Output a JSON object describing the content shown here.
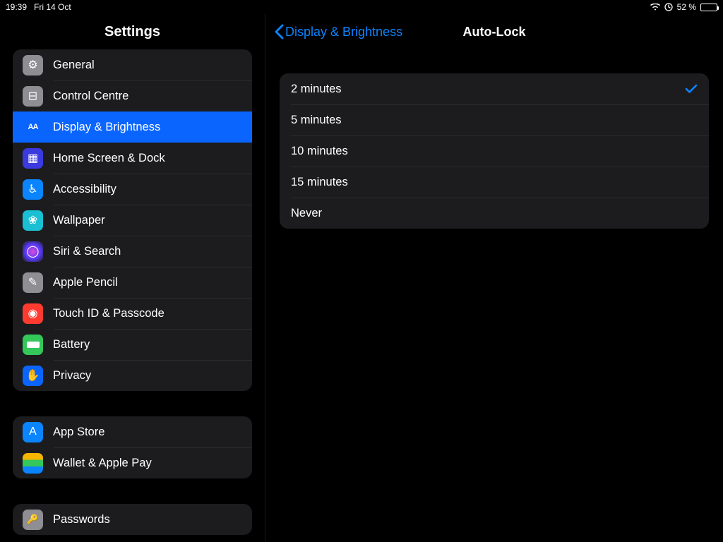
{
  "status": {
    "time": "19:39",
    "date": "Fri 14 Oct",
    "battery_pct": "52 %",
    "battery_fill_pct": 52
  },
  "sidebar": {
    "title": "Settings",
    "groups": [
      {
        "items": [
          {
            "id": "general",
            "label": "General",
            "icon": "gear-icon",
            "bg": "#8e8e93",
            "glyph": "⚙︎"
          },
          {
            "id": "control-centre",
            "label": "Control Centre",
            "icon": "switches-icon",
            "bg": "#8e8e93",
            "glyph": "⊟"
          },
          {
            "id": "display",
            "label": "Display & Brightness",
            "icon": "aa-icon",
            "bg": "#0a65ff",
            "glyph": "AA",
            "selected": true
          },
          {
            "id": "home-screen",
            "label": "Home Screen & Dock",
            "icon": "grid-icon",
            "bg": "#3a3adf",
            "glyph": "▦"
          },
          {
            "id": "accessibility",
            "label": "Accessibility",
            "icon": "person-circle-icon",
            "bg": "#0a84ff",
            "glyph": "♿︎"
          },
          {
            "id": "wallpaper",
            "label": "Wallpaper",
            "icon": "flower-icon",
            "bg": "#1bbfd3",
            "glyph": "❀"
          },
          {
            "id": "siri",
            "label": "Siri & Search",
            "icon": "siri-icon",
            "bg": "#1c1c1e",
            "glyph": "◯"
          },
          {
            "id": "pencil",
            "label": "Apple Pencil",
            "icon": "pencil-icon",
            "bg": "#8e8e93",
            "glyph": "✎"
          },
          {
            "id": "touchid",
            "label": "Touch ID & Passcode",
            "icon": "fingerprint-icon",
            "bg": "#ff3b30",
            "glyph": "◉"
          },
          {
            "id": "battery",
            "label": "Battery",
            "icon": "battery-icon",
            "bg": "#34c759",
            "glyph": "▮"
          },
          {
            "id": "privacy",
            "label": "Privacy",
            "icon": "hand-icon",
            "bg": "#0a65ff",
            "glyph": "✋"
          }
        ]
      },
      {
        "items": [
          {
            "id": "app-store",
            "label": "App Store",
            "icon": "appstore-icon",
            "bg": "#0a84ff",
            "glyph": "A"
          },
          {
            "id": "wallet",
            "label": "Wallet & Apple Pay",
            "icon": "wallet-icon",
            "bg": "#1c1c1e",
            "glyph": "▭"
          }
        ]
      },
      {
        "items": [
          {
            "id": "passwords",
            "label": "Passwords",
            "icon": "key-icon",
            "bg": "#8e8e93",
            "glyph": "🔑"
          }
        ]
      }
    ]
  },
  "detail": {
    "back_label": "Display & Brightness",
    "title": "Auto-Lock",
    "options": [
      {
        "label": "2 minutes",
        "selected": true
      },
      {
        "label": "5 minutes",
        "selected": false
      },
      {
        "label": "10 minutes",
        "selected": false
      },
      {
        "label": "15 minutes",
        "selected": false
      },
      {
        "label": "Never",
        "selected": false
      }
    ]
  },
  "colors": {
    "accent": "#0a84ff",
    "row_selected": "#0a65ff",
    "panel": "#1c1c1e",
    "separator": "#2c2c2e"
  }
}
